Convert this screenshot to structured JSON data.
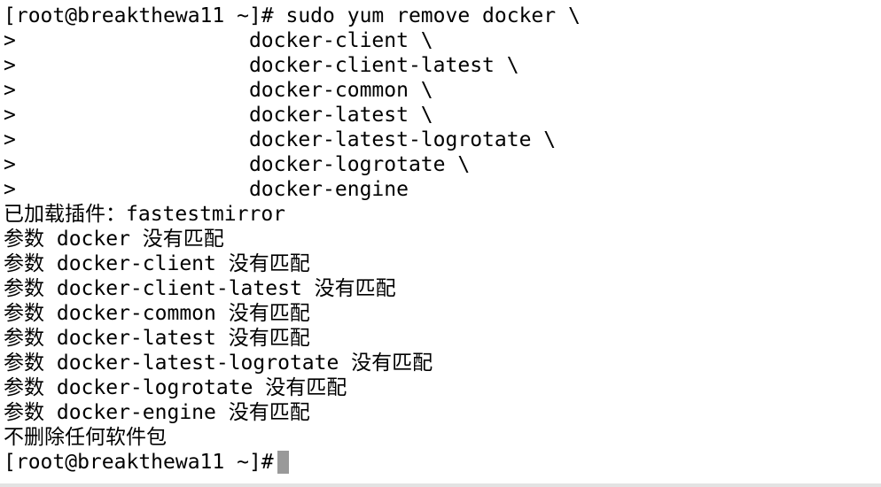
{
  "terminal": {
    "lines": [
      "[root@breakthewa11 ~]# sudo yum remove docker \\",
      ">                   docker-client \\",
      ">                   docker-client-latest \\",
      ">                   docker-common \\",
      ">                   docker-latest \\",
      ">                   docker-latest-logrotate \\",
      ">                   docker-logrotate \\",
      ">                   docker-engine",
      "已加载插件：fastestmirror",
      "参数 docker 没有匹配",
      "参数 docker-client 没有匹配",
      "参数 docker-client-latest 没有匹配",
      "参数 docker-common 没有匹配",
      "参数 docker-latest 没有匹配",
      "参数 docker-latest-logrotate 没有匹配",
      "参数 docker-logrotate 没有匹配",
      "参数 docker-engine 没有匹配",
      "不删除任何软件包"
    ],
    "prompt": "[root@breakthewa11 ~]#",
    "colors": {
      "background": "#ffffff",
      "text": "#000000",
      "cursor": "#999999"
    }
  }
}
